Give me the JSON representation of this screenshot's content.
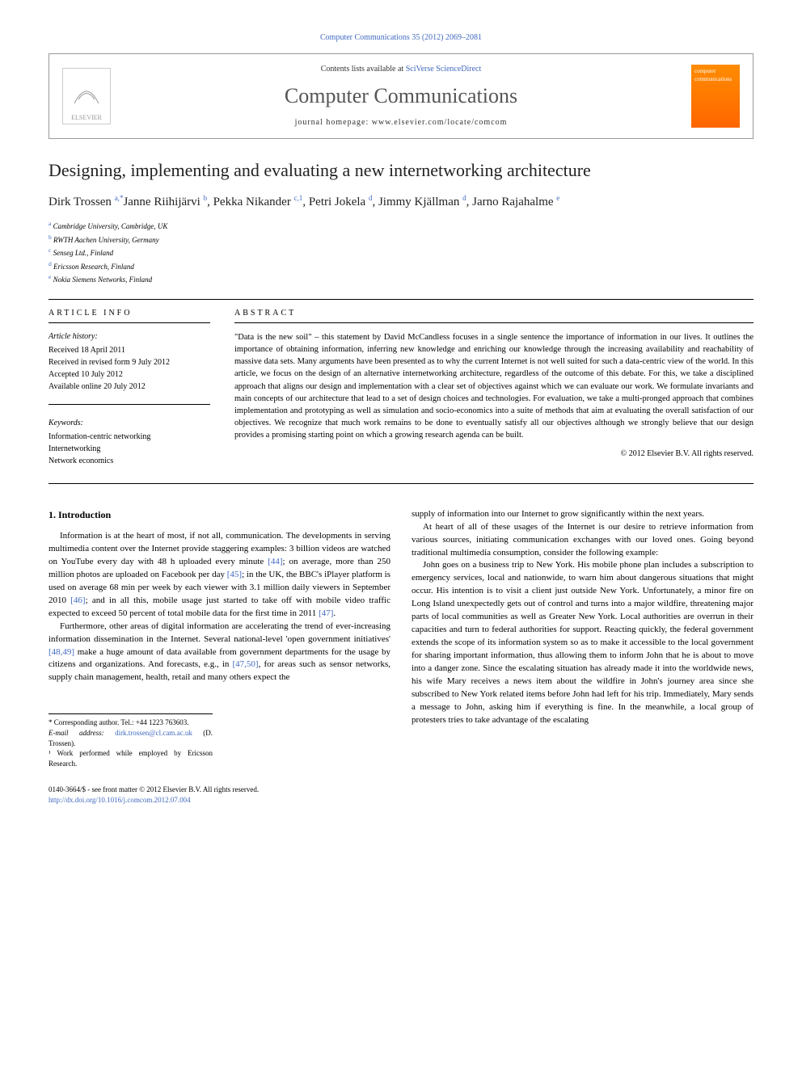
{
  "header": {
    "citation": "Computer Communications 35 (2012) 2069–2081",
    "contents_prefix": "Contents lists available at ",
    "contents_link": "SciVerse ScienceDirect",
    "journal_title": "Computer Communications",
    "homepage": "journal homepage: www.elsevier.com/locate/comcom",
    "publisher": "ELSEVIER",
    "cover_label": "computer communications"
  },
  "article": {
    "title": "Designing, implementing and evaluating a new internetworking architecture",
    "authors_html": "Dirk Trossen <sup>a,*</sup>Janne Riihijärvi <sup>b</sup>, Pekka Nikander <sup>c,1</sup>, Petri Jokela <sup>d</sup>, Jimmy Kjällman <sup>d</sup>, Jarno Rajahalme <sup>e</sup>",
    "affiliations": [
      {
        "sup": "a",
        "text": "Cambridge University, Cambridge, UK"
      },
      {
        "sup": "b",
        "text": "RWTH Aachen University, Germany"
      },
      {
        "sup": "c",
        "text": "Senseg Ltd., Finland"
      },
      {
        "sup": "d",
        "text": "Ericsson Research, Finland"
      },
      {
        "sup": "e",
        "text": "Nokia Siemens Networks, Finland"
      }
    ]
  },
  "info": {
    "heading": "ARTICLE INFO",
    "history_heading": "Article history:",
    "history": [
      "Received 18 April 2011",
      "Received in revised form 9 July 2012",
      "Accepted 10 July 2012",
      "Available online 20 July 2012"
    ],
    "keywords_heading": "Keywords:",
    "keywords": [
      "Information-centric networking",
      "Internetworking",
      "Network economics"
    ]
  },
  "abstract": {
    "heading": "ABSTRACT",
    "text": "\"Data is the new soil\" – this statement by David McCandless focuses in a single sentence the importance of information in our lives. It outlines the importance of obtaining information, inferring new knowledge and enriching our knowledge through the increasing availability and reachability of massive data sets. Many arguments have been presented as to why the current Internet is not well suited for such a data-centric view of the world. In this article, we focus on the design of an alternative internetworking architecture, regardless of the outcome of this debate. For this, we take a disciplined approach that aligns our design and implementation with a clear set of objectives against which we can evaluate our work. We formulate invariants and main concepts of our architecture that lead to a set of design choices and technologies. For evaluation, we take a multi-pronged approach that combines implementation and prototyping as well as simulation and socio-economics into a suite of methods that aim at evaluating the overall satisfaction of our objectives. We recognize that much work remains to be done to eventually satisfy all our objectives although we strongly believe that our design provides a promising starting point on which a growing research agenda can be built.",
    "copyright": "© 2012 Elsevier B.V. All rights reserved."
  },
  "body": {
    "section_heading": "1. Introduction",
    "col1": [
      "Information is at the heart of most, if not all, communication. The developments in serving multimedia content over the Internet provide staggering examples: 3 billion videos are watched on YouTube every day with 48 h uploaded every minute [44]; on average, more than 250 million photos are uploaded on Facebook per day [45]; in the UK, the BBC's iPlayer platform is used on average 68 min per week by each viewer with 3.1 million daily viewers in September 2010 [46]; and in all this, mobile usage just started to take off with mobile video traffic expected to exceed 50 percent of total mobile data for the first time in 2011 [47].",
      "Furthermore, other areas of digital information are accelerating the trend of ever-increasing information dissemination in the Internet. Several national-level 'open government initiatives' [48,49] make a huge amount of data available from government departments for the usage by citizens and organizations. And forecasts, e.g., in [47,50], for areas such as sensor networks, supply chain management, health, retail and many others expect the"
    ],
    "col2": [
      "supply of information into our Internet to grow significantly within the next years.",
      "At heart of all of these usages of the Internet is our desire to retrieve information from various sources, initiating communication exchanges with our loved ones. Going beyond traditional multimedia consumption, consider the following example:",
      "John goes on a business trip to New York. His mobile phone plan includes a subscription to emergency services, local and nationwide, to warn him about dangerous situations that might occur. His intention is to visit a client just outside New York. Unfortunately, a minor fire on Long Island unexpectedly gets out of control and turns into a major wildfire, threatening major parts of local communities as well as Greater New York. Local authorities are overrun in their capacities and turn to federal authorities for support. Reacting quickly, the federal government extends the scope of its information system so as to make it accessible to the local government for sharing important information, thus allowing them to inform John that he is about to move into a danger zone. Since the escalating situation has already made it into the worldwide news, his wife Mary receives a news item about the wildfire in John's journey area since she subscribed to New York related items before John had left for his trip. Immediately, Mary sends a message to John, asking him if everything is fine. In the meanwhile, a local group of protesters tries to take advantage of the escalating"
    ]
  },
  "footnotes": {
    "corr": "* Corresponding author. Tel.: +44 1223 763603.",
    "email_label": "E-mail address:",
    "email": "dirk.trossen@cl.cam.ac.uk",
    "email_suffix": "(D. Trossen).",
    "note1": "¹ Work performed while employed by Ericsson Research."
  },
  "footer": {
    "issn": "0140-3664/$ - see front matter © 2012 Elsevier B.V. All rights reserved.",
    "doi": "http://dx.doi.org/10.1016/j.comcom.2012.07.004"
  }
}
